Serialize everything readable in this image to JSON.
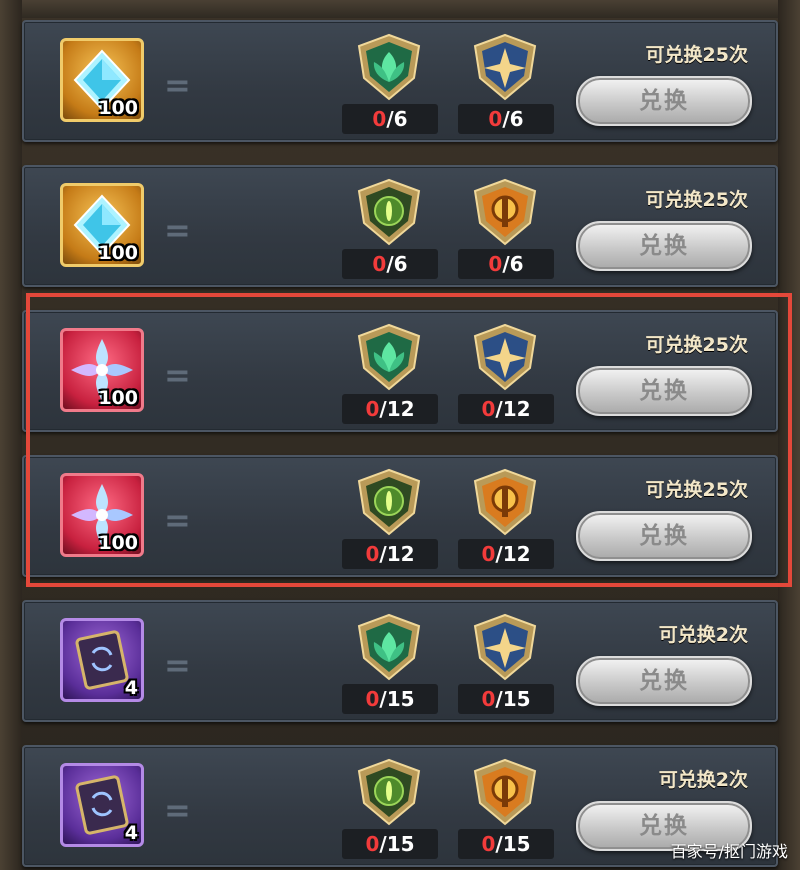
{
  "rows": [
    {
      "item": "crystal",
      "quantity": "100",
      "badges": [
        "leaf-emblem",
        "star-emblem"
      ],
      "counts": [
        {
          "cur": "0",
          "max": "/6"
        },
        {
          "cur": "0",
          "max": "/6"
        }
      ],
      "limit": "可兑换25次",
      "button": "兑换"
    },
    {
      "item": "crystal",
      "quantity": "100",
      "badges": [
        "eye-emblem",
        "flame-emblem"
      ],
      "counts": [
        {
          "cur": "0",
          "max": "/6"
        },
        {
          "cur": "0",
          "max": "/6"
        }
      ],
      "limit": "可兑换25次",
      "button": "兑换"
    },
    {
      "item": "flower-shard",
      "quantity": "100",
      "badges": [
        "leaf-emblem",
        "star-emblem"
      ],
      "counts": [
        {
          "cur": "0",
          "max": "/12"
        },
        {
          "cur": "0",
          "max": "/12"
        }
      ],
      "limit": "可兑换25次",
      "button": "兑换"
    },
    {
      "item": "flower-shard",
      "quantity": "100",
      "badges": [
        "eye-emblem",
        "flame-emblem"
      ],
      "counts": [
        {
          "cur": "0",
          "max": "/12"
        },
        {
          "cur": "0",
          "max": "/12"
        }
      ],
      "limit": "可兑换25次",
      "button": "兑换"
    },
    {
      "item": "scroll",
      "quantity": "4",
      "badges": [
        "leaf-emblem",
        "star-emblem"
      ],
      "counts": [
        {
          "cur": "0",
          "max": "/15"
        },
        {
          "cur": "0",
          "max": "/15"
        }
      ],
      "limit": "可兑换2次",
      "button": "兑换"
    },
    {
      "item": "scroll",
      "quantity": "4",
      "badges": [
        "eye-emblem",
        "flame-emblem"
      ],
      "counts": [
        {
          "cur": "0",
          "max": "/15"
        },
        {
          "cur": "0",
          "max": "/15"
        }
      ],
      "limit": "可兑换2次",
      "button": "兑换"
    }
  ],
  "equals_sign": "=",
  "watermark": "百家号/抠门游戏",
  "colors": {
    "highlight": "#e4483a",
    "count_current": "#f23b3b"
  }
}
